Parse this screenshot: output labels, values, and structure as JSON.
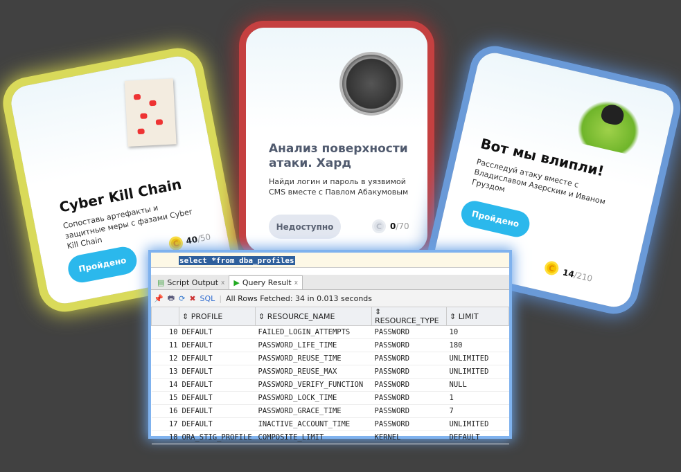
{
  "cards": [
    {
      "title": "Cyber Kill Chain",
      "description": "Сопоставь артефакты и защитные меры с фазами Cyber Kill Chain",
      "button": "Пройдено",
      "score": "40",
      "max": "/50",
      "glow": "#d9da5a"
    },
    {
      "title": "Анализ поверхности атаки. Хард",
      "description": "Найди логин и пароль в уязвимой CMS вместе с Павлом Абакумовым",
      "button": "Недоступно",
      "score": "0",
      "max": "/70",
      "glow": "#c54040"
    },
    {
      "title": "Вот мы влипли!",
      "description": "Расследуй атаку вместе с Владиславом Азерским и Иваном Груздом",
      "button": "Пройдено",
      "score": "14",
      "max": "/210",
      "glow": "#6a9ad8"
    }
  ],
  "coin_symbol": "C",
  "sql": {
    "query": "select *from dba_profiles",
    "tabs": [
      "Script Output",
      "Query Result"
    ],
    "tab_close": "x",
    "sql_link": "SQL",
    "status": "All Rows Fetched: 34 in 0.013 seconds",
    "columns": [
      "PROFILE",
      "RESOURCE_NAME",
      "RESOURCE_TYPE",
      "LIMIT"
    ],
    "rows": [
      [
        "10",
        "DEFAULT",
        "FAILED_LOGIN_ATTEMPTS",
        "PASSWORD",
        "10"
      ],
      [
        "11",
        "DEFAULT",
        "PASSWORD_LIFE_TIME",
        "PASSWORD",
        "180"
      ],
      [
        "12",
        "DEFAULT",
        "PASSWORD_REUSE_TIME",
        "PASSWORD",
        "UNLIMITED"
      ],
      [
        "13",
        "DEFAULT",
        "PASSWORD_REUSE_MAX",
        "PASSWORD",
        "UNLIMITED"
      ],
      [
        "14",
        "DEFAULT",
        "PASSWORD_VERIFY_FUNCTION",
        "PASSWORD",
        "NULL"
      ],
      [
        "15",
        "DEFAULT",
        "PASSWORD_LOCK_TIME",
        "PASSWORD",
        "1"
      ],
      [
        "16",
        "DEFAULT",
        "PASSWORD_GRACE_TIME",
        "PASSWORD",
        "7"
      ],
      [
        "17",
        "DEFAULT",
        "INACTIVE_ACCOUNT_TIME",
        "PASSWORD",
        "UNLIMITED"
      ],
      [
        "18",
        "ORA_STIG_PROFILE",
        "COMPOSITE_LIMIT",
        "KERNEL",
        "DEFAULT"
      ]
    ]
  }
}
